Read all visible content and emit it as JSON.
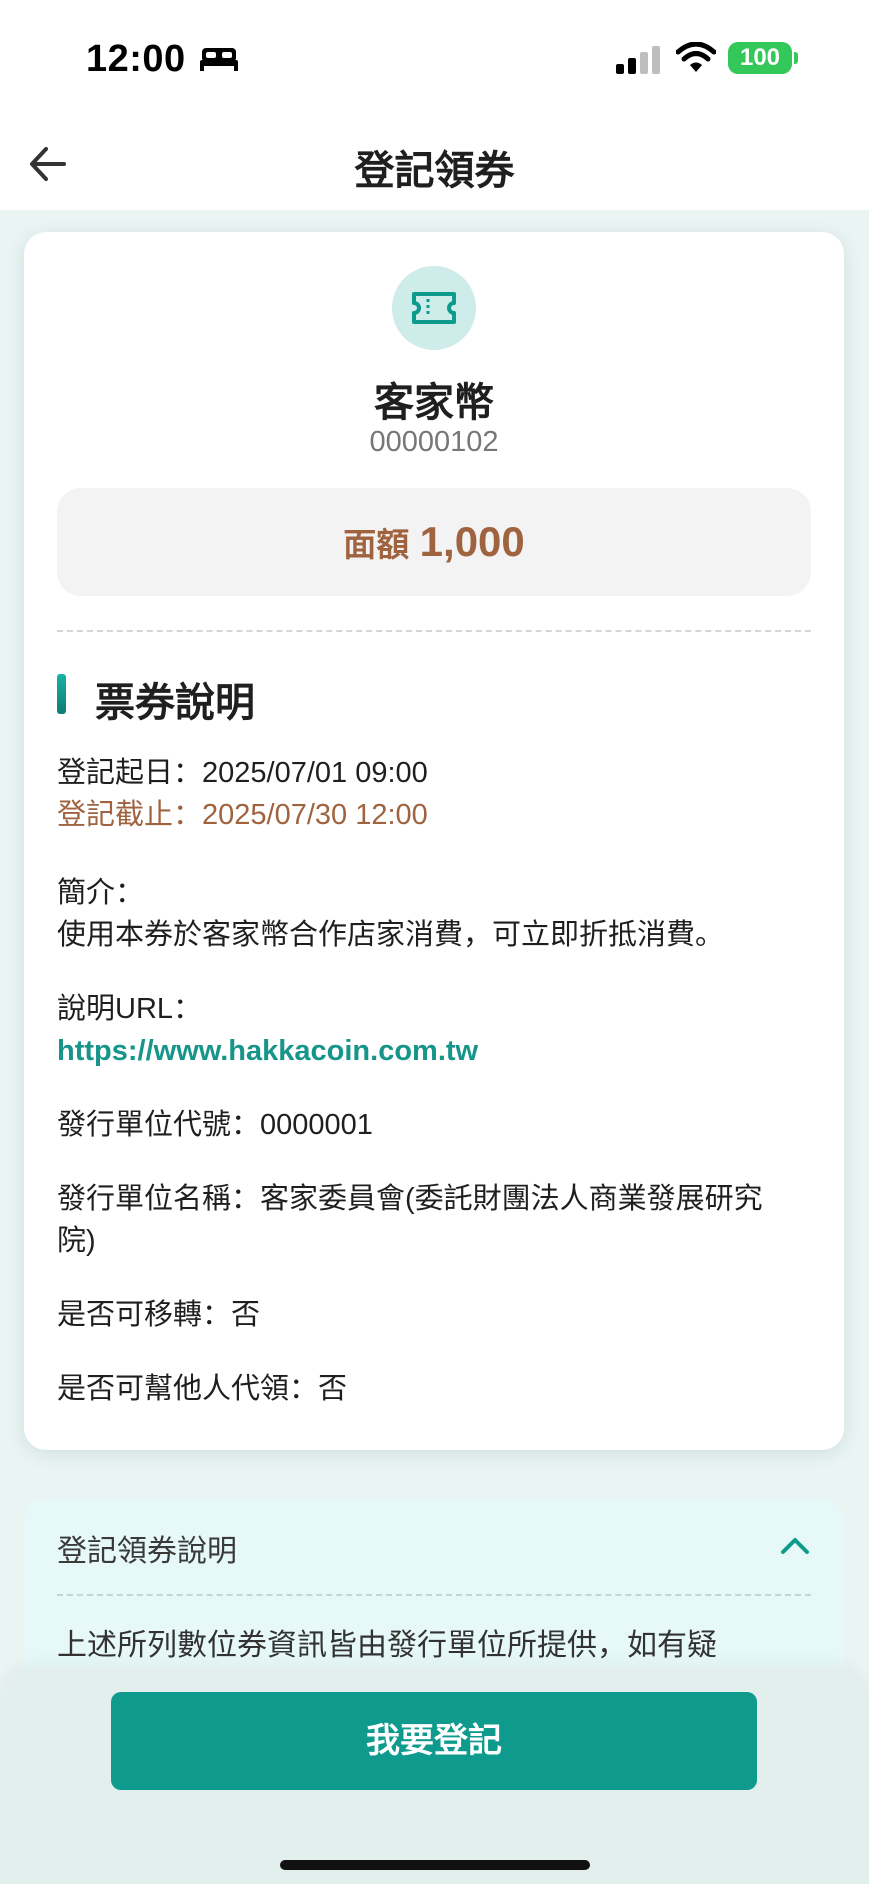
{
  "status_bar": {
    "time": "12:00",
    "battery": "100",
    "icons": [
      "bed-icon",
      "signal-icon",
      "wifi-icon",
      "battery-icon"
    ]
  },
  "header": {
    "title": "登記領券",
    "back_icon": "arrow-left-icon"
  },
  "coupon": {
    "icon": "ticket-icon",
    "name": "客家幣",
    "id": "00000102",
    "amount_label": "面額",
    "amount_value": "1,000"
  },
  "section": {
    "title": "票券說明",
    "start_date": "登記起日：2025/07/01 09:00",
    "end_date": "登記截止：2025/07/30 12:00",
    "intro_label": "簡介：",
    "intro_text": "使用本券於客家幣合作店家消費，可立即折抵消費。",
    "url_label": "說明URL：",
    "url": "https://www.hakkacoin.com.tw",
    "issuer_code": "發行單位代號：0000001",
    "issuer_name_line1": "發行單位名稱：客家委員會(委託財團法人商業發展研究",
    "issuer_name_line2": "院)",
    "transferable": "是否可移轉：否",
    "proxy": "是否可幫他人代領：否"
  },
  "panel": {
    "title": "登記領券說明",
    "text": "上述所列數位券資訊皆由發行單位所提供，如有疑"
  },
  "footer": {
    "button_label": "我要登記"
  },
  "colors": {
    "primary": "#0e9b8e",
    "accent_brown": "#a0633f",
    "link": "#17958a",
    "panel_bg": "#e6f8f7"
  }
}
